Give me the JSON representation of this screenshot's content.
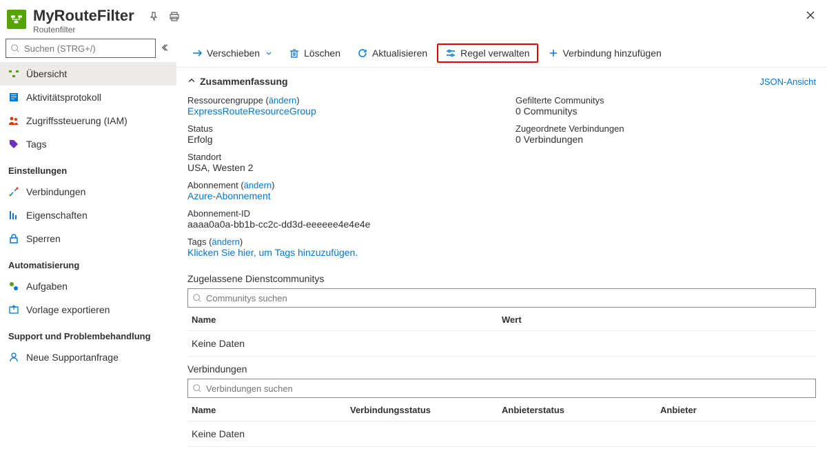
{
  "header": {
    "title": "MyRouteFilter",
    "subtitle": "Routenfilter"
  },
  "sidebar": {
    "search_placeholder": "Suchen (STRG+/)",
    "items_top": [
      {
        "label": "Übersicht"
      },
      {
        "label": "Aktivitätsprotokoll"
      },
      {
        "label": "Zugriffssteuerung (IAM)"
      },
      {
        "label": "Tags"
      }
    ],
    "group_settings": "Einstellungen",
    "items_settings": [
      {
        "label": "Verbindungen"
      },
      {
        "label": "Eigenschaften"
      },
      {
        "label": "Sperren"
      }
    ],
    "group_automation": "Automatisierung",
    "items_automation": [
      {
        "label": "Aufgaben"
      },
      {
        "label": "Vorlage exportieren"
      }
    ],
    "group_support": "Support und Problembehandlung",
    "items_support": [
      {
        "label": "Neue Supportanfrage"
      }
    ]
  },
  "toolbar": {
    "move": "Verschieben",
    "delete": "Löschen",
    "refresh": "Aktualisieren",
    "manage_rule": "Regel verwalten",
    "add_connection": "Verbindung hinzufügen"
  },
  "summary": {
    "header": "Zusammenfassung",
    "json_view": "JSON-Ansicht",
    "change": "ändern",
    "resource_group_label": "Ressourcengruppe",
    "resource_group_value": "ExpressRouteResourceGroup",
    "status_label": "Status",
    "status_value": "Erfolg",
    "location_label": "Standort",
    "location_value": "USA, Westen 2",
    "subscription_label": "Abonnement",
    "subscription_value": "Azure-Abonnement",
    "subscription_id_label": "Abonnement-ID",
    "subscription_id_value": "aaaa0a0a-bb1b-cc2c-dd3d-eeeeee4e4e4e",
    "tags_label": "Tags",
    "tags_value": "Klicken Sie hier, um Tags hinzuzufügen.",
    "filtered_label": "Gefilterte Communitys",
    "filtered_value": "0 Communitys",
    "assoc_label": "Zugeordnete Verbindungen",
    "assoc_value": "0 Verbindungen"
  },
  "communities": {
    "title": "Zugelassene Dienstcommunitys",
    "search_placeholder": "Communitys suchen",
    "col_name": "Name",
    "col_value": "Wert",
    "empty": "Keine Daten"
  },
  "connections": {
    "title": "Verbindungen",
    "search_placeholder": "Verbindungen suchen",
    "col_name": "Name",
    "col_status": "Verbindungsstatus",
    "col_provider_status": "Anbieterstatus",
    "col_provider": "Anbieter",
    "empty": "Keine Daten"
  }
}
